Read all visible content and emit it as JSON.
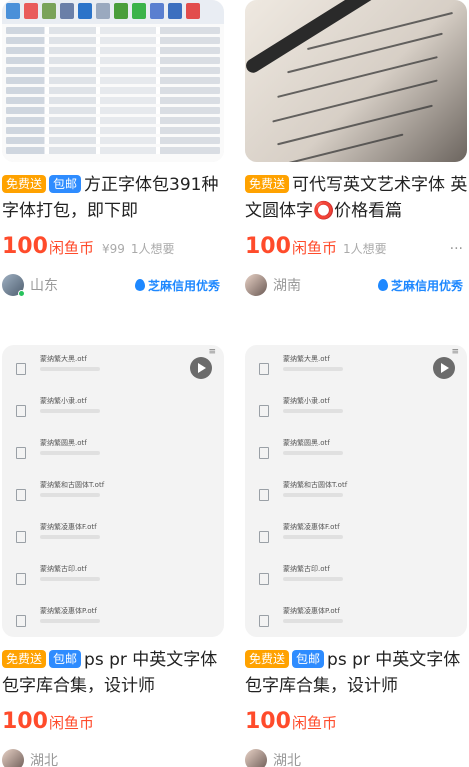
{
  "tags": {
    "free": "免费送",
    "mail": "包邮"
  },
  "cards": [
    {
      "title": "方正字体包391种字体打包，即下即",
      "price": "100",
      "price_unit": "闲鱼币",
      "orig_price": "¥99",
      "want": "1人想要",
      "city": "山东",
      "credit": "芝麻信用优秀",
      "thumb": "font-software-screenshot"
    },
    {
      "title": "可代写英文艺术字体 英文圆体字⭕价格看篇",
      "price": "100",
      "price_unit": "闲鱼币",
      "orig_price": "",
      "want": "1人想要",
      "city": "湖南",
      "credit": "芝麻信用优秀",
      "more": "···",
      "thumb": "calligraphy-handwriting-photo"
    },
    {
      "title": "ps pr 中英文字体包字库合集，设计师",
      "price": "100",
      "price_unit": "闲鱼币",
      "city": "湖北",
      "thumb": "font-file-list",
      "files": [
        "蒙纳繁大黑.otf",
        "蒙纳繁小隶.otf",
        "蒙纳繁圆黑.otf",
        "蒙纳繁和古圆体T.otf",
        "蒙纳繁凌惠体F.otf",
        "蒙纳繁古印.otf",
        "蒙纳繁凌惠体P.otf"
      ]
    },
    {
      "title": "ps pr 中英文字体包字库合集，设计师",
      "price": "100",
      "price_unit": "闲鱼币",
      "city": "湖北",
      "thumb": "font-file-list",
      "files": [
        "蒙纳繁大黑.otf",
        "蒙纳繁小隶.otf",
        "蒙纳繁圆黑.otf",
        "蒙纳繁和古圆体T.otf",
        "蒙纳繁凌惠体F.otf",
        "蒙纳繁古印.otf",
        "蒙纳繁凌惠体P.otf"
      ]
    }
  ],
  "colors": {
    "price": "#ff4b2b",
    "tag_free": "#ffa200",
    "tag_mail": "#2e8cff",
    "credit": "#1e88ff"
  }
}
